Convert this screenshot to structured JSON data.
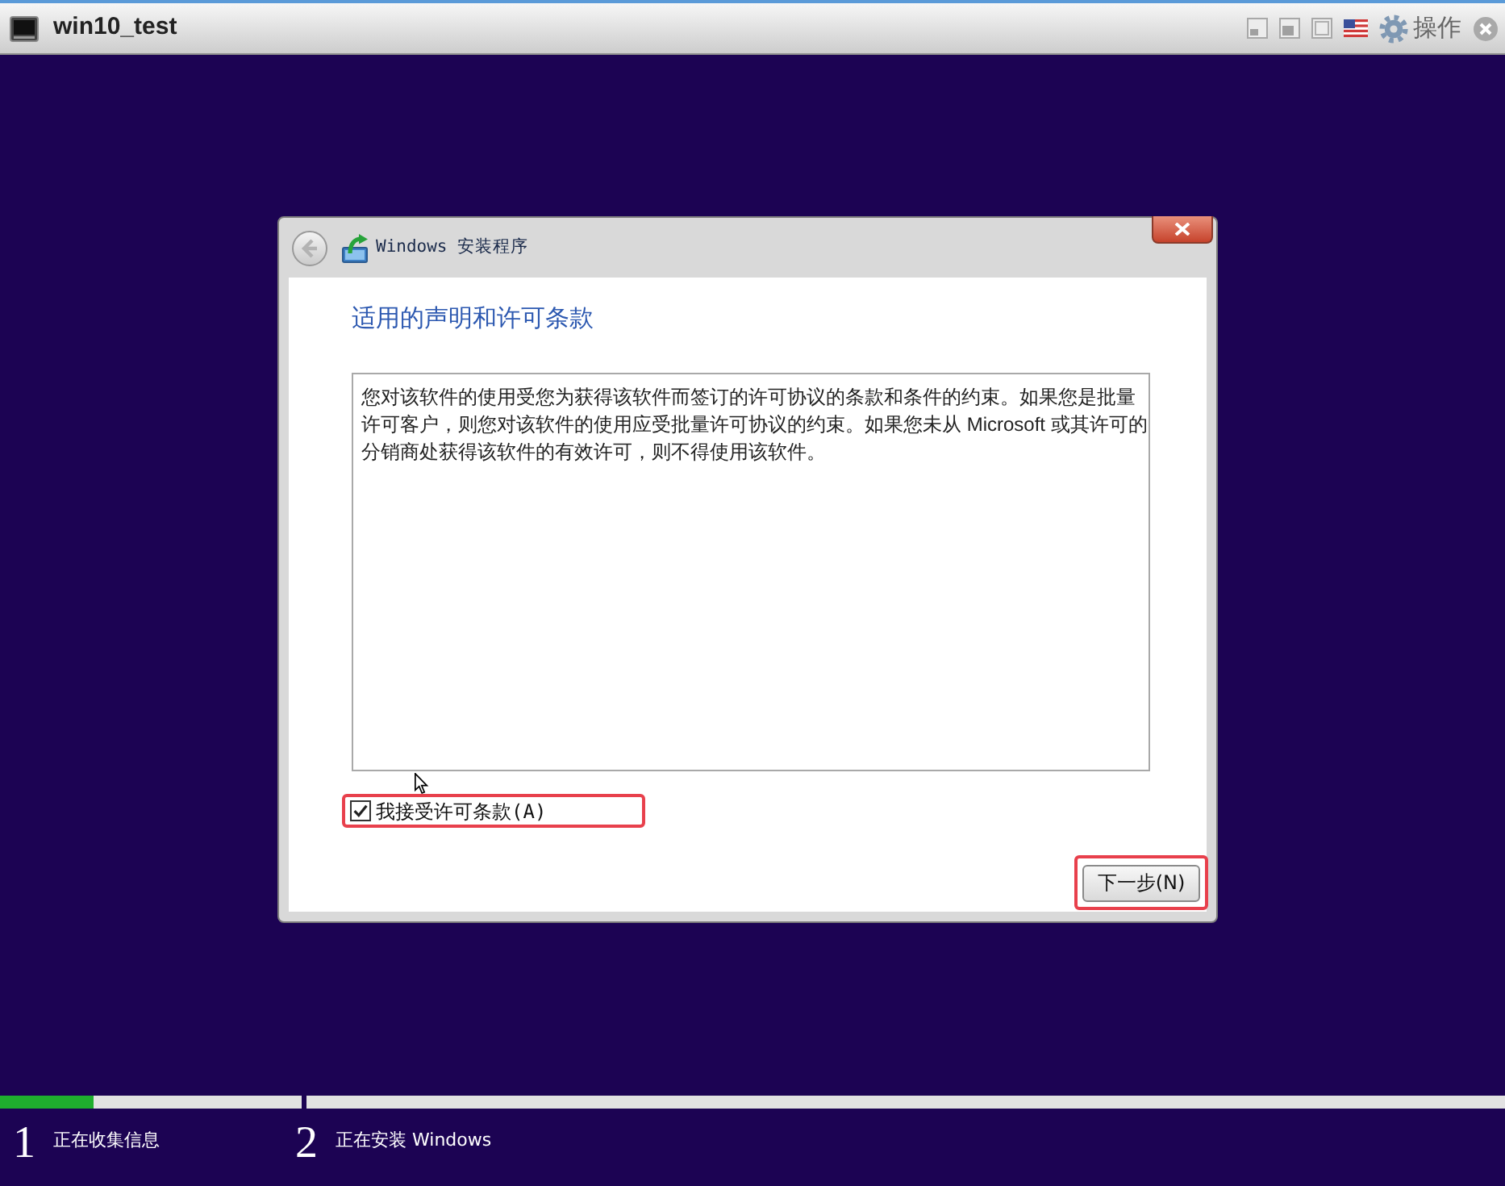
{
  "window": {
    "title": "win10_test",
    "menu_label": "操作"
  },
  "setup_dialog": {
    "title": "Windows 安装程序",
    "heading": "适用的声明和许可条款",
    "license_text": "您对该软件的使用受您为获得该软件而签订的许可协议的条款和条件的约束。如果您是批量许可客户，则您对该软件的使用应受批量许可协议的约束。如果您未从 Microsoft 或其许可的分销商处获得该软件的有效许可，则不得使用该软件。",
    "accept_checkbox": {
      "label": "我接受许可条款(A)",
      "checked": true,
      "highlighted": true
    },
    "next_button": {
      "label": "下一步(N)",
      "highlighted": true
    }
  },
  "progress_steps": [
    {
      "number": "1",
      "label": "正在收集信息",
      "level": 0.31
    },
    {
      "number": "2",
      "label": "正在安装 Windows"
    }
  ]
}
